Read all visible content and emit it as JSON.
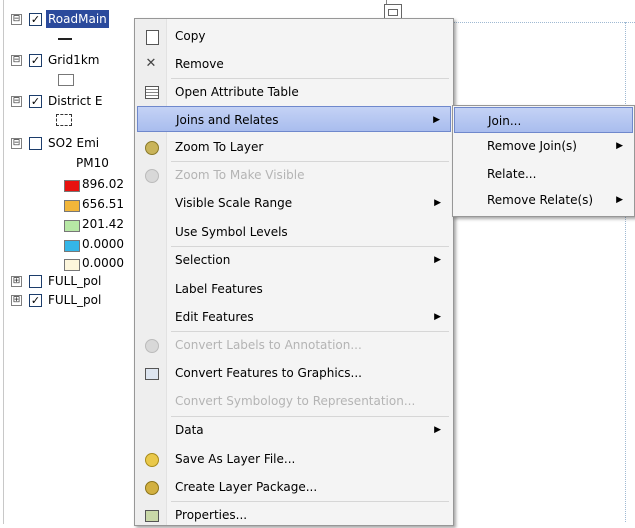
{
  "toc": {
    "layers": [
      {
        "label": "RoadMain",
        "expander": "⊟",
        "checked": "✓"
      },
      {
        "label": "Grid1km",
        "expander": "⊟",
        "checked": "✓"
      },
      {
        "label": "District E",
        "expander": "⊟",
        "checked": "✓"
      },
      {
        "label": "SO2 Emi",
        "expander": "⊟",
        "checked": ""
      },
      {
        "label": "FULL_pol",
        "expander": "⊞",
        "checked": ""
      },
      {
        "label": "FULL_pol",
        "expander": "⊞",
        "checked": "✓"
      }
    ],
    "field_name": "PM10",
    "legend": [
      {
        "label": "896.02",
        "color": "#e8120f"
      },
      {
        "label": "656.51",
        "color": "#f2b63a"
      },
      {
        "label": "201.42",
        "color": "#b7e8a5"
      },
      {
        "label": "0.0000",
        "color": "#34b6e8"
      },
      {
        "label": "0.0000",
        "color": "#fdf6dc"
      }
    ]
  },
  "menu": {
    "items": [
      {
        "label": "Copy",
        "icon": "copy-icon",
        "enabled": true
      },
      {
        "label": "Remove",
        "icon": "remove-icon",
        "glyph": "✕",
        "enabled": true
      },
      {
        "label": "Open Attribute Table",
        "icon": "table-icon",
        "enabled": true
      },
      {
        "label": "Joins and Relates",
        "enabled": true,
        "submenu": true,
        "highlighted": true
      },
      {
        "label": "Zoom To Layer",
        "icon": "zoom-layer-icon",
        "enabled": true
      },
      {
        "label": "Zoom To Make Visible",
        "icon": "zoom-visible-icon",
        "enabled": false
      },
      {
        "label": "Visible Scale Range",
        "enabled": true,
        "submenu": true
      },
      {
        "label": "Use Symbol Levels",
        "enabled": true
      },
      {
        "label": "Selection",
        "enabled": true,
        "submenu": true
      },
      {
        "label": "Label Features",
        "enabled": true
      },
      {
        "label": "Edit Features",
        "enabled": true,
        "submenu": true
      },
      {
        "label": "Convert Labels to Annotation...",
        "icon": "annotation-icon",
        "enabled": false
      },
      {
        "label": "Convert Features to Graphics...",
        "icon": "graphics-icon",
        "enabled": true
      },
      {
        "label": "Convert Symbology to Representation...",
        "enabled": false
      },
      {
        "label": "Data",
        "enabled": true,
        "submenu": true
      },
      {
        "label": "Save As Layer File...",
        "icon": "layer-file-icon",
        "enabled": true
      },
      {
        "label": "Create Layer Package...",
        "icon": "layer-package-icon",
        "enabled": true
      },
      {
        "label": "Properties...",
        "icon": "properties-icon",
        "enabled": true
      }
    ]
  },
  "submenu": {
    "items": [
      {
        "label": "Join...",
        "highlighted": true,
        "submenu": false
      },
      {
        "label": "Remove Join(s)",
        "submenu": true
      },
      {
        "label": "Relate...",
        "submenu": false
      },
      {
        "label": "Remove Relate(s)",
        "submenu": true
      }
    ]
  },
  "arrow_glyph": "▶"
}
